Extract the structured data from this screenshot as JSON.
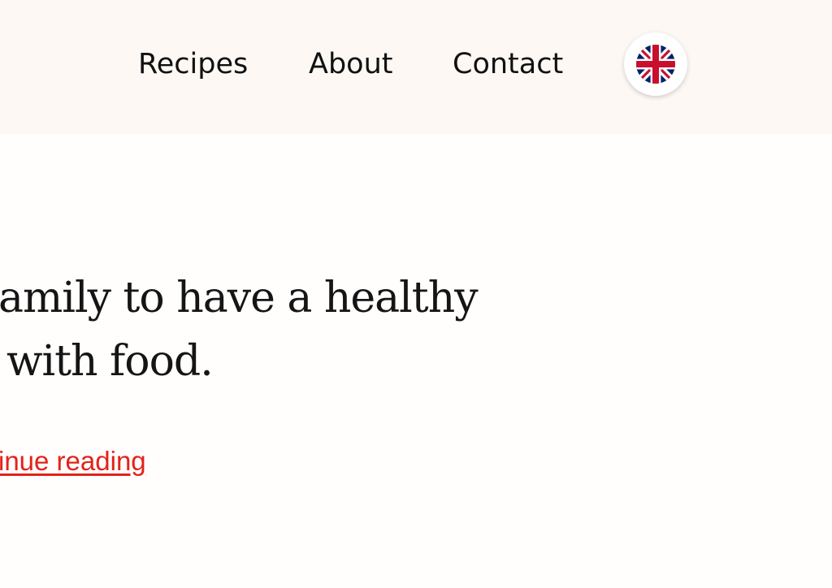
{
  "header": {
    "nav": {
      "recipes": "Recipes",
      "about": "About",
      "contact": "Contact"
    },
    "language_icon": "uk-flag-icon",
    "colors": {
      "background": "#fdf8f4",
      "flag_blue": "#012169",
      "flag_red": "#c8102e"
    }
  },
  "article": {
    "excerpt_line_1": "amily to have a healthy",
    "excerpt_line_2": " with food.",
    "read_more": "inue reading",
    "link_color": "#e2231a"
  }
}
